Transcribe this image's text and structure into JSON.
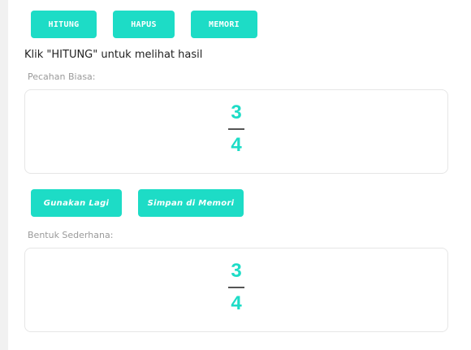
{
  "toolbar": {
    "hitung_label": "HITUNG",
    "hapus_label": "HAPUS",
    "memori_label": "MEMORI"
  },
  "instruction": "Klik \"HITUNG\" untuk melihat hasil",
  "pecahan_biasa": {
    "label": "Pecahan Biasa:",
    "numerator": "3",
    "denominator": "4"
  },
  "actions": {
    "gunakan_label": "Gunakan Lagi",
    "simpan_label": "Simpan di Memori"
  },
  "bentuk_sederhana": {
    "label": "Bentuk Sederhana:",
    "numerator": "3",
    "denominator": "4"
  },
  "colors": {
    "accent": "#1ddcc6",
    "background": "#f1f1f1"
  }
}
